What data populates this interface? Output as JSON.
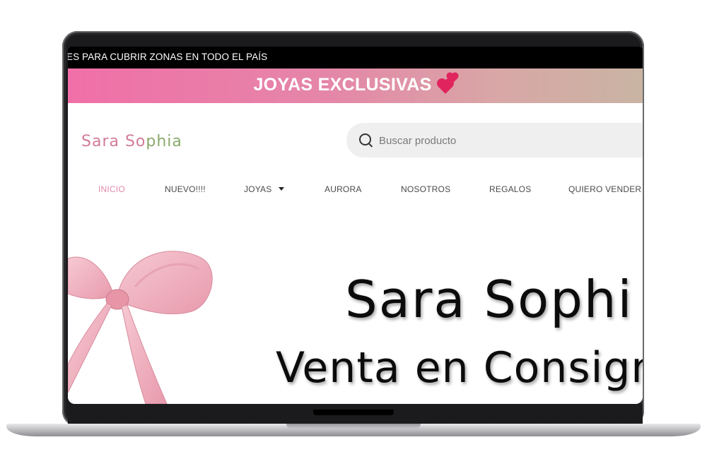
{
  "ticker": {
    "text": "ES PARA CUBRIR ZONAS EN TODO EL PAÍS"
  },
  "promo": {
    "text": "JOYAS EXCLUSIVAS",
    "icon": "two-hearts-icon"
  },
  "header": {
    "logo_part1": "Sara So",
    "logo_part2": "phia",
    "search_placeholder": "Buscar producto"
  },
  "nav": {
    "items": [
      {
        "label": "INICIO"
      },
      {
        "label": "NUEVO!!!!"
      },
      {
        "label": "JOYAS"
      },
      {
        "label": "AURORA"
      },
      {
        "label": "NOSOTROS"
      },
      {
        "label": "REGALOS"
      },
      {
        "label": "QUIERO VENDER"
      }
    ]
  },
  "hero": {
    "title": "Sara Sophi",
    "subtitle": "Venta en Consign"
  },
  "colors": {
    "promo_start": "#f06fa8",
    "promo_end": "#c9b4a3",
    "logo_pink": "#d27b9a",
    "logo_green": "#8aa96b",
    "nav_active": "#e08aab",
    "ribbon": "#f2b8c4"
  }
}
